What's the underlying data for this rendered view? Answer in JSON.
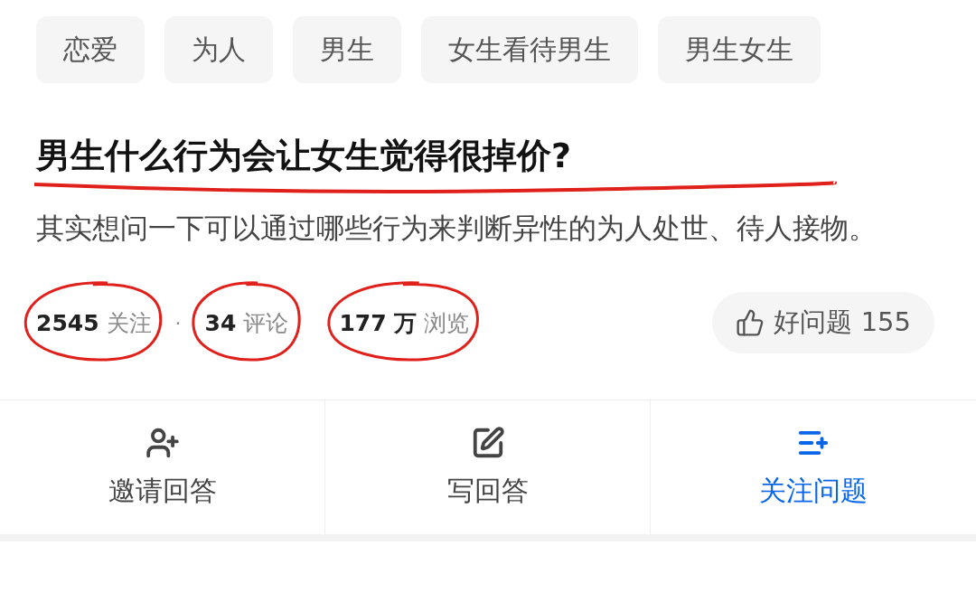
{
  "tags": [
    {
      "label": "恋爱"
    },
    {
      "label": "为人"
    },
    {
      "label": "男生"
    },
    {
      "label": "女生看待男生"
    },
    {
      "label": "男生女生"
    }
  ],
  "question": {
    "title": "男生什么行为会让女生觉得很掉价?",
    "underlined": true,
    "description": "其实想问一下可以通过哪些行为来判断异性的为人处世、待人接物。"
  },
  "stats": [
    {
      "value": "2545",
      "label": "关注",
      "circled": true,
      "separator": "·"
    },
    {
      "value": "34",
      "label": "评论",
      "circled": true
    },
    {
      "value": "177 万",
      "label": "浏览",
      "circled": true
    }
  ],
  "good_question": {
    "label": "好问题 155"
  },
  "actions": [
    {
      "kind": "invite",
      "label": "邀请回答",
      "highlighted": false
    },
    {
      "kind": "write",
      "label": "写回答",
      "highlighted": false
    },
    {
      "kind": "follow",
      "label": "关注问题",
      "highlighted": true
    }
  ]
}
